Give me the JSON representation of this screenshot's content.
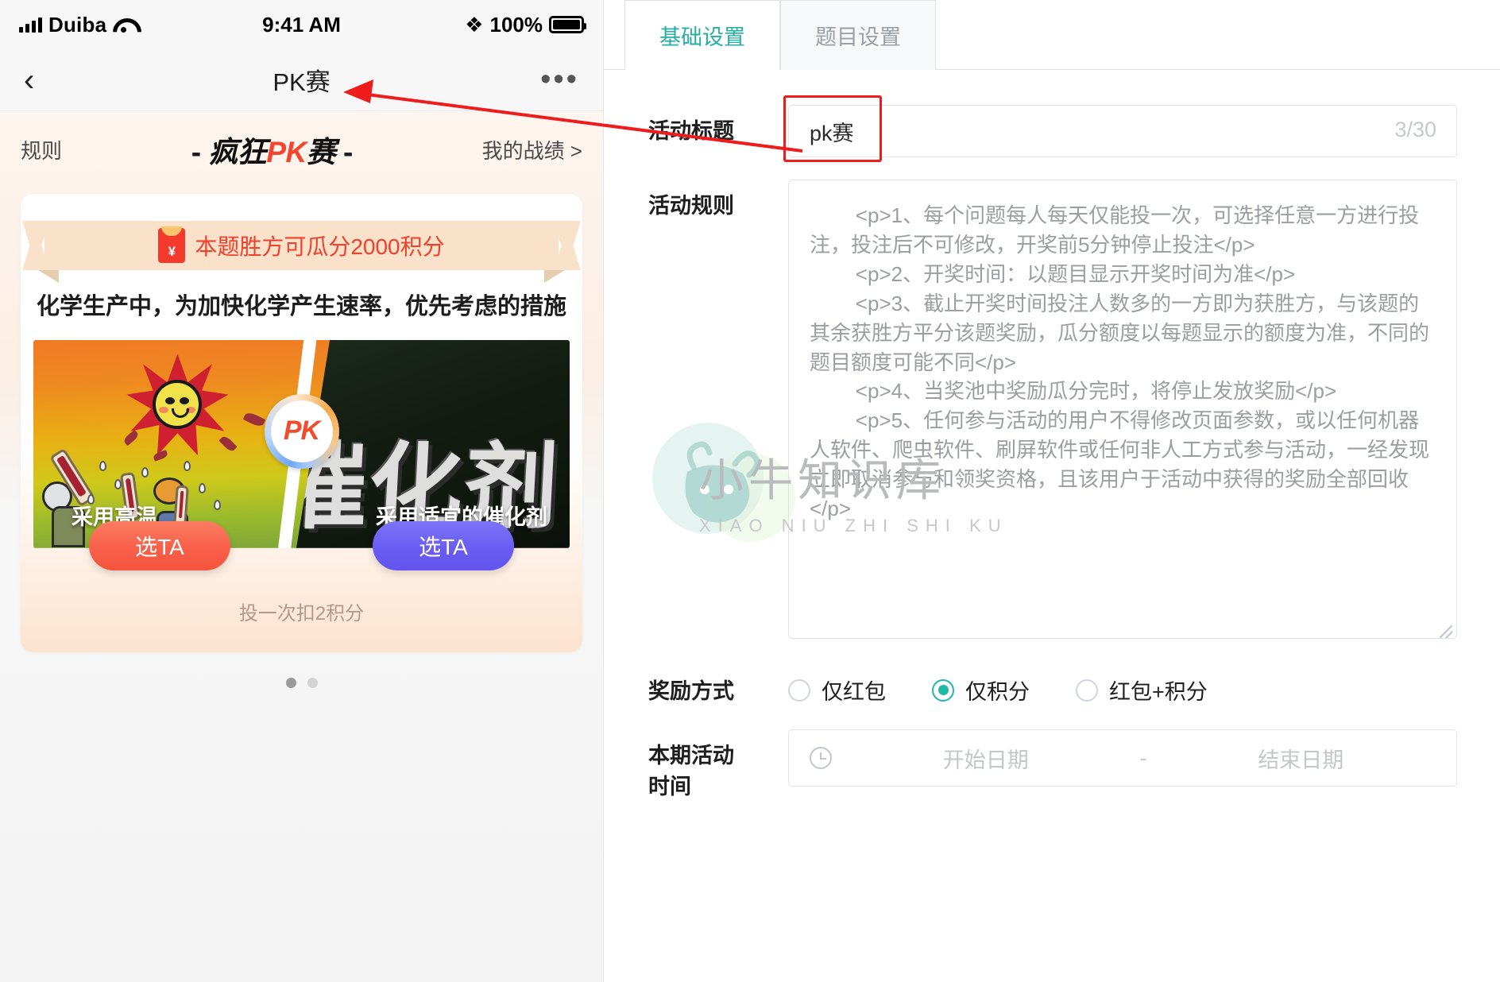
{
  "phone": {
    "statusbar": {
      "carrier": "Duiba",
      "time": "9:41 AM",
      "battery": "100%"
    },
    "navbar": {
      "back_icon": "chevron-left-icon",
      "title": "PK赛",
      "more_icon": "ellipsis-icon"
    },
    "page_header": {
      "rules_link": "规则",
      "title_dash_left": "-",
      "title_black": "疯狂",
      "title_red": "PK",
      "title_black2": "赛",
      "title_dash_right": "-",
      "my_record": "我的战绩 >"
    },
    "card": {
      "ribbon_text": "本题胜方可瓜分2000积分",
      "ribbon_icon": "red-envelope-icon",
      "question": "化学生产中，为加快化学产生速率，优先考虑的措施",
      "pk_badge": "PK",
      "left_option_label": "采用高温",
      "right_option_label": "采用适宜的催化剂",
      "right_bg_word": "催化剂",
      "left_button": "选TA",
      "right_button": "选TA",
      "cost_text": "投一次扣2积分"
    },
    "carousel": {
      "total": 2,
      "active": 1
    }
  },
  "admin": {
    "tabs": [
      {
        "label": "基础设置",
        "active": true
      },
      {
        "label": "题目设置",
        "active": false
      }
    ],
    "fields": {
      "title": {
        "label": "活动标题",
        "value": "pk赛",
        "counter": "3/30"
      },
      "rules": {
        "label": "活动规则",
        "value": "        <p>1、每个问题每人每天仅能投一次，可选择任意一方进行投注，投注后不可修改，开奖前5分钟停止投注</p>\n        <p>2、开奖时间：以题目显示开奖时间为准</p>\n        <p>3、截止开奖时间投注人数多的一方即为获胜方，与该题的其余获胜方平分该题奖励，瓜分额度以每题显示的额度为准，不同的题目额度可能不同</p>\n        <p>4、当奖池中奖励瓜分完时，将停止发放奖励</p>\n        <p>5、任何参与活动的用户不得修改页面参数，或以任何机器人软件、爬虫软件、刷屏软件或任何非人工方式参与活动，一经发现立即取消参与和领奖资格，且该用户于活动中获得的奖励全部回收</p>"
      },
      "reward_type": {
        "label": "奖励方式",
        "options": [
          {
            "label": "仅红包",
            "selected": false
          },
          {
            "label": "仅积分",
            "selected": true
          },
          {
            "label": "红包+积分",
            "selected": false
          }
        ]
      },
      "activity_time": {
        "label": "本期活动\n时间",
        "label_line1": "本期活动",
        "label_line2": "时间",
        "icon": "clock-icon",
        "start_placeholder": "开始日期",
        "separator": "-",
        "end_placeholder": "结束日期"
      }
    }
  },
  "watermark": {
    "main": "小牛知识库",
    "sub": "XIAO NIU ZHI SHI KU"
  },
  "annotation": {
    "color": "#ee1c1c",
    "type": "arrow-pointing-to-phone-title"
  },
  "colors": {
    "accent_teal": "#27b0a2",
    "annotation_red": "#ee1c1c",
    "pk_red": "#f4452e",
    "btn_left": "#f8604a",
    "btn_right": "#6a5cf2"
  }
}
